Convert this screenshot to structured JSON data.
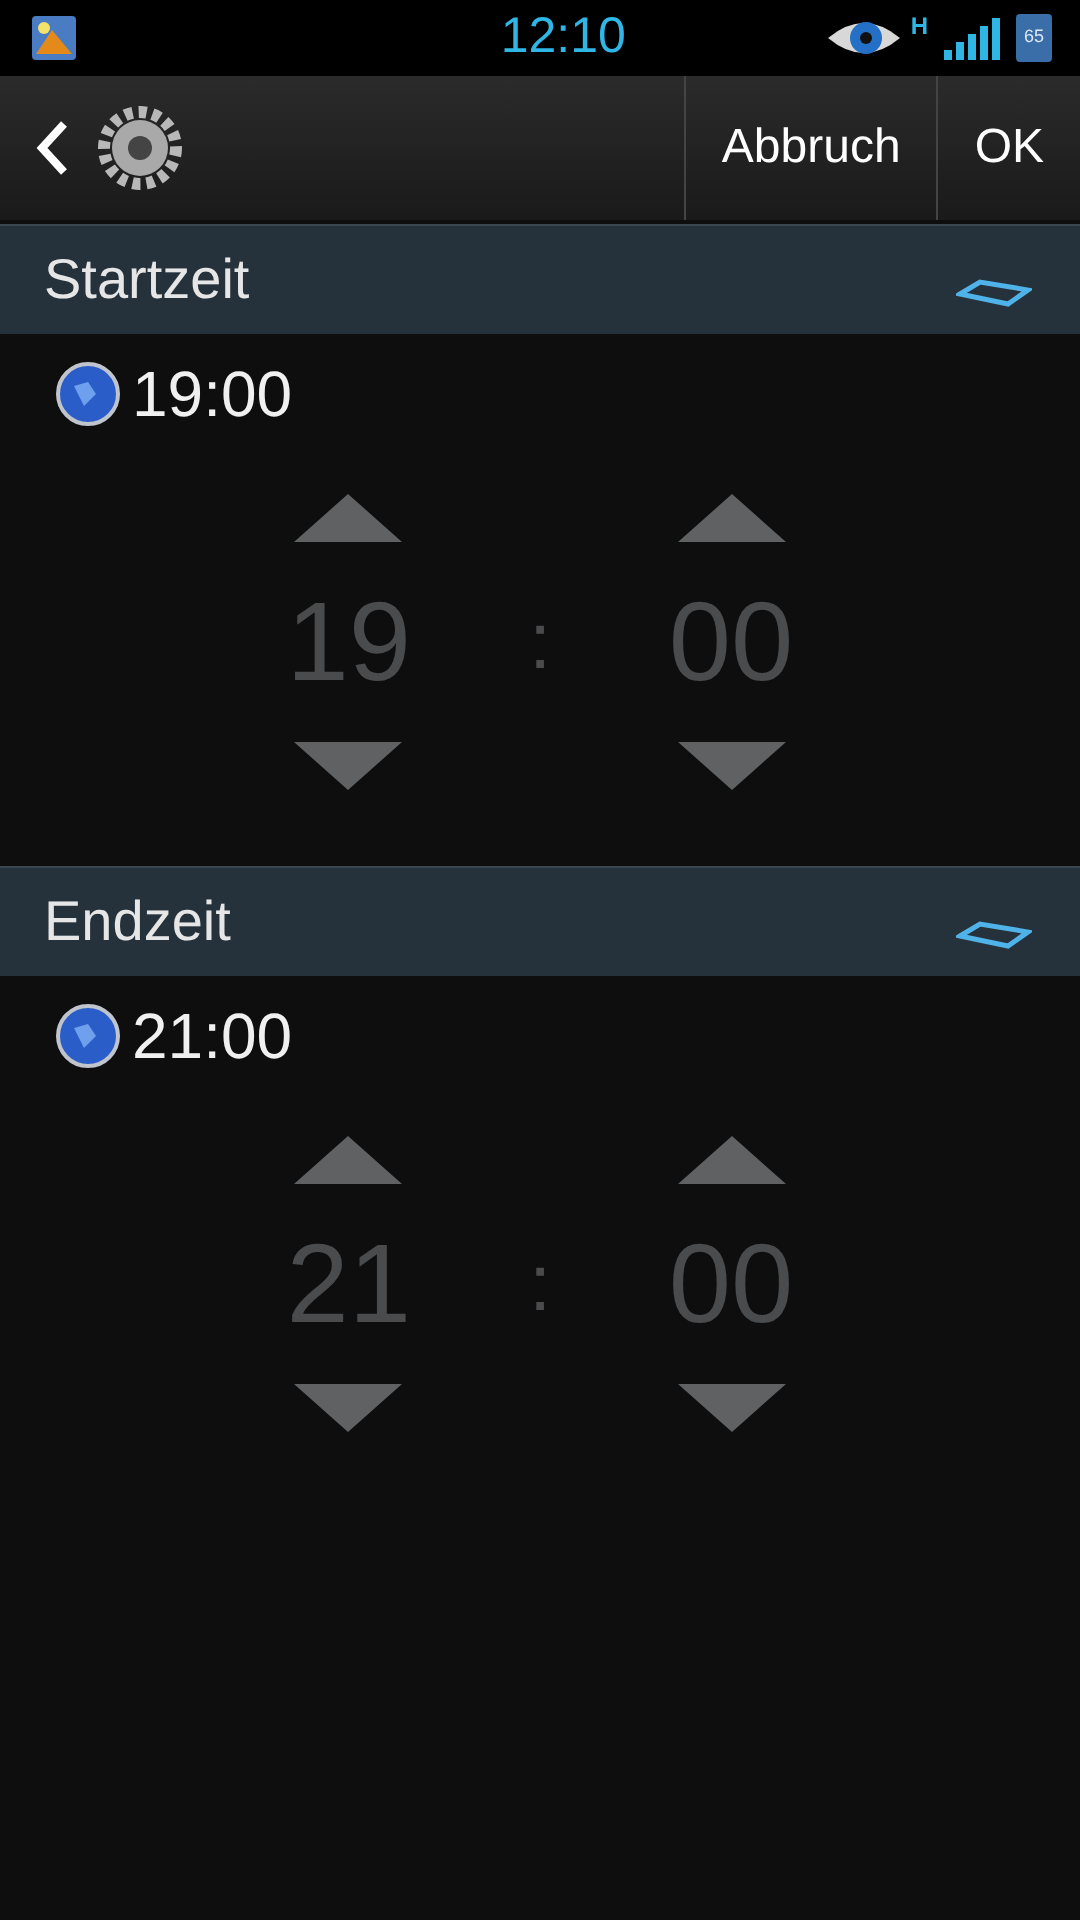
{
  "status_bar": {
    "time": "12:10",
    "network": "H",
    "battery": "65"
  },
  "action_bar": {
    "buttons": [
      "Abbruch",
      "OK"
    ]
  },
  "sections": [
    {
      "title": "Startzeit",
      "summary": "19:00",
      "hours": "19",
      "separator": ":",
      "minutes": "00"
    },
    {
      "title": "Endzeit",
      "summary": "21:00",
      "hours": "21",
      "separator": ":",
      "minutes": "00"
    }
  ]
}
